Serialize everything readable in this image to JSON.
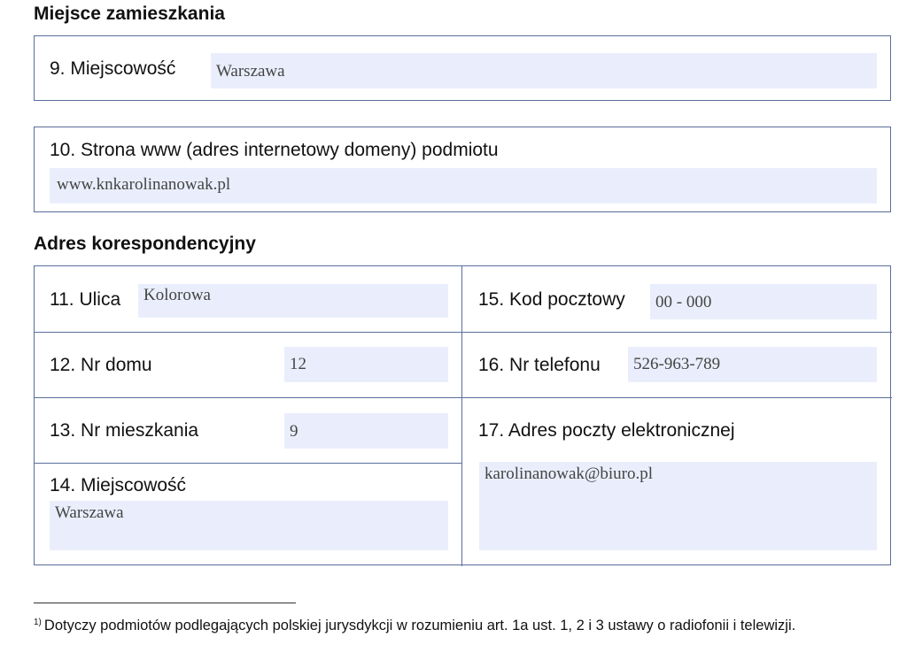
{
  "residence": {
    "title": "Miejsce zamieszkania",
    "city": {
      "label": "9. Miejscowość",
      "value": "Warszawa"
    },
    "website": {
      "label": "10. Strona www (adres internetowy domeny) podmiotu",
      "value": "www.knkarolinanowak.pl"
    }
  },
  "correspondence": {
    "title": "Adres korespondencyjny",
    "street": {
      "label": "11. Ulica",
      "value": "Kolorowa"
    },
    "postal_code": {
      "label": "15. Kod pocztowy",
      "value": "00 - 000"
    },
    "house_no": {
      "label": "12. Nr domu",
      "value": "12"
    },
    "phone": {
      "label": "16. Nr telefonu",
      "value": "526-963-789"
    },
    "apartment_no": {
      "label": "13. Nr mieszkania",
      "value": "9"
    },
    "email": {
      "label": "17. Adres poczty elektronicznej",
      "value": "karolinanowak@biuro.pl"
    },
    "city": {
      "label": "14. Miejscowość",
      "value": "Warszawa"
    }
  },
  "footnote": {
    "marker": "1)",
    "text": "Dotyczy podmiotów podlegających polskiej jurysdykcji w rozumieniu art. 1a ust. 1, 2 i 3 ustawy o radiofonii i telewizji."
  }
}
